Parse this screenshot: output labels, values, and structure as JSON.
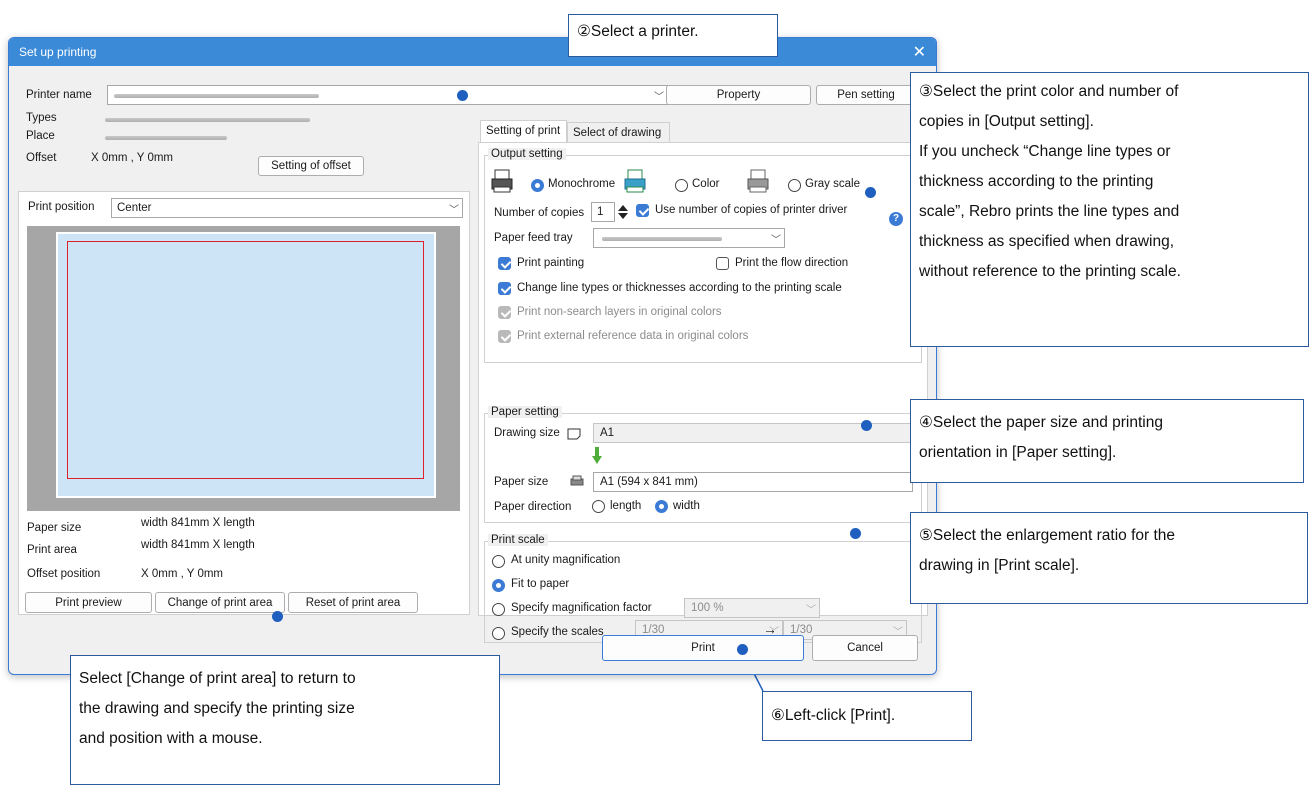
{
  "dialog": {
    "title": "Set up printing",
    "close_glyph": "✕",
    "printer_name_label": "Printer name",
    "property_button": "Property",
    "pen_setting_button": "Pen setting",
    "types_label": "Types",
    "place_label": "Place",
    "offset_label": "Offset",
    "offset_value": "X 0mm , Y 0mm",
    "setting_of_offset_button": "Setting of offset",
    "print_position_label": "Print position",
    "print_position_value": "Center",
    "paper_size_label": "Paper size",
    "paper_size_value": "width 841mm X length",
    "print_area_label": "Print area",
    "print_area_value": "width 841mm X length",
    "offset_position_label": "Offset position",
    "offset_position_value": "X 0mm , Y 0mm",
    "print_preview_button": "Print preview",
    "change_print_area_button": "Change of print area",
    "reset_print_area_button": "Reset of print area",
    "tabs": [
      "Setting of print",
      "Select of drawing"
    ],
    "output_setting": {
      "title": "Output setting",
      "monochrome": "Monochrome",
      "color": "Color",
      "gray_scale": "Gray scale",
      "number_of_copies_label": "Number of copies",
      "number_of_copies_value": "1",
      "use_copies_driver": "Use number of copies of printer driver",
      "paper_feed_tray_label": "Paper feed tray",
      "print_painting": "Print painting",
      "print_flow_direction": "Print the flow direction",
      "change_line_types": "Change line types or thicknesses according to the printing scale",
      "print_non_search": "Print non-search layers in original colors",
      "print_external_ref": "Print external reference data in original colors"
    },
    "paper_setting": {
      "title": "Paper setting",
      "drawing_size_label": "Drawing size",
      "drawing_size_value": "A1",
      "paper_size_label": "Paper size",
      "paper_size_value": "A1 (594 x 841 mm)",
      "paper_direction_label": "Paper direction",
      "length": "length",
      "width": "width"
    },
    "print_scale": {
      "title": "Print scale",
      "at_unity": "At unity magnification",
      "fit_to_paper": "Fit to paper",
      "specify_magnification": "Specify magnification factor",
      "magnification_value": "100 %",
      "specify_scales": "Specify the scales",
      "scale_from": "1/30",
      "scale_arrow": "→",
      "scale_to": "1/30"
    },
    "print_button": "Print",
    "cancel_button": "Cancel",
    "help_glyph": "?"
  },
  "callouts": {
    "c2": "②Select a printer.",
    "c3": [
      "③Select the print color and number of",
      "copies in [Output setting].",
      "If you uncheck “Change line types or",
      "thickness according to the printing",
      "scale”, Rebro prints the line types and",
      "thickness as specified when drawing,",
      "without reference to the printing scale."
    ],
    "c4": [
      "④Select the paper size and printing",
      "orientation in [Paper setting]."
    ],
    "c5": [
      "⑤Select the enlargement ratio for the",
      "drawing in [Print scale]."
    ],
    "c6": "⑥Left-click [Print].",
    "c_area": [
      "Select [Change of print area] to return to",
      "the drawing and specify the printing size",
      "and position with a mouse."
    ]
  },
  "colors": {
    "title_bar": "#3b8ad8",
    "accent": "#3b7bd5",
    "callout_line": "#1f5fbf",
    "preview_paper": "#cde4f7",
    "print_area_border": "#e0202a"
  }
}
